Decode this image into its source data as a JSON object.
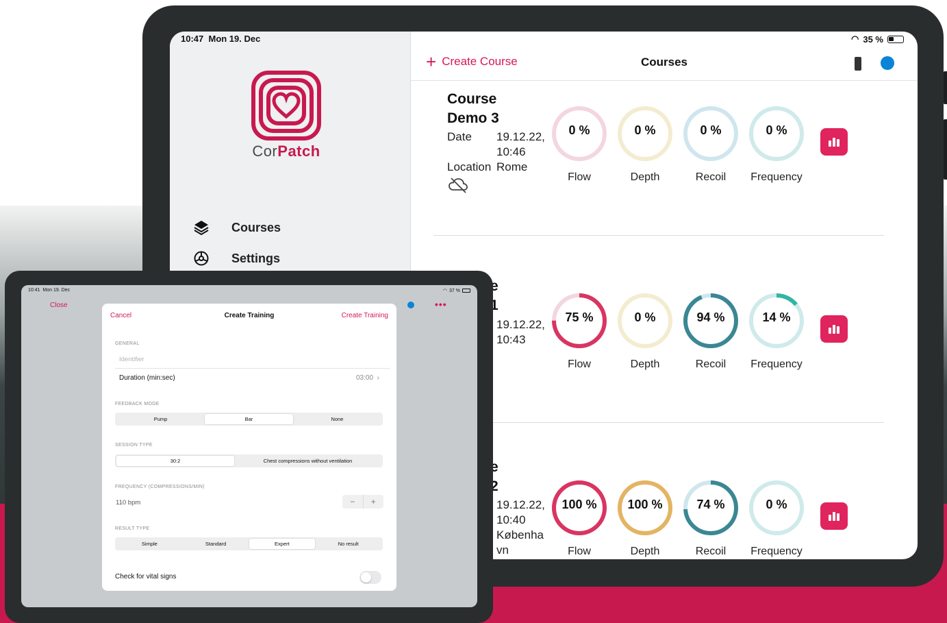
{
  "colors": {
    "brand": "#c8194f",
    "accent": "#d4185a",
    "blue_dot": "#0a84d6",
    "flow": "#d93562",
    "depth": "#e3b463",
    "recoil": "#3b8793",
    "frequency": "#32b5a4"
  },
  "back_tablet": {
    "status": {
      "time": "10:47",
      "date": "Mon 19. Dec",
      "battery": "35 %"
    },
    "sidebar": {
      "logo_text_a": "Cor",
      "logo_text_b": "Patch",
      "items": [
        {
          "label": "Courses",
          "icon": "layers-icon"
        },
        {
          "label": "Settings",
          "icon": "gear-icon"
        }
      ]
    },
    "header": {
      "create_label": "Create Course",
      "title": "Courses"
    },
    "courses": [
      {
        "name_lines": [
          "Course",
          "Demo 3"
        ],
        "date_label": "Date",
        "date": "19.12.22,",
        "time": "10:46",
        "location_label": "Location",
        "location": "Rome",
        "metrics": [
          {
            "label": "Flow",
            "value": "0 %",
            "pct": 0
          },
          {
            "label": "Depth",
            "value": "0 %",
            "pct": 0
          },
          {
            "label": "Recoil",
            "value": "0 %",
            "pct": 0
          },
          {
            "label": "Frequency",
            "value": "0 %",
            "pct": 0
          }
        ]
      },
      {
        "name_lines": [
          "e",
          "1"
        ],
        "date": "19.12.22,",
        "time": "10:43",
        "metrics": [
          {
            "label": "Flow",
            "value": "75 %",
            "pct": 75
          },
          {
            "label": "Depth",
            "value": "0 %",
            "pct": 0
          },
          {
            "label": "Recoil",
            "value": "94 %",
            "pct": 94
          },
          {
            "label": "Frequency",
            "value": "14 %",
            "pct": 14
          }
        ]
      },
      {
        "name_lines": [
          "e",
          "2"
        ],
        "date": "19.12.22,",
        "time": "10:40",
        "location_lines": [
          "Københa",
          "vn"
        ],
        "metrics": [
          {
            "label": "Flow",
            "value": "100 %",
            "pct": 100
          },
          {
            "label": "Depth",
            "value": "100 %",
            "pct": 100
          },
          {
            "label": "Recoil",
            "value": "74 %",
            "pct": 74
          },
          {
            "label": "Frequency",
            "value": "0 %",
            "pct": 0
          }
        ]
      }
    ]
  },
  "front_tablet": {
    "status": {
      "time": "10:41",
      "date": "Mon 19. Dec",
      "battery": "37 %"
    },
    "close_label": "Close",
    "modal": {
      "cancel": "Cancel",
      "title": "Create Training",
      "create": "Create Training",
      "general_header": "GENERAL",
      "identifier_placeholder": "Identifier",
      "duration_label": "Duration (min:sec)",
      "duration_value": "03:00",
      "feedback_header": "FEEDBACK MODE",
      "feedback_options": [
        "Pump",
        "Bar",
        "None"
      ],
      "session_header": "SESSION TYPE",
      "session_options": [
        "30:2",
        "Chest compressions without ventilation"
      ],
      "frequency_header": "FREQUENCY (COMPRESSIONS/MIN)",
      "frequency_value": "110 bpm",
      "result_header": "RESULT TYPE",
      "result_options": [
        "Simple",
        "Standard",
        "Expert",
        "No result"
      ],
      "vital_label": "Check for vital signs"
    }
  }
}
